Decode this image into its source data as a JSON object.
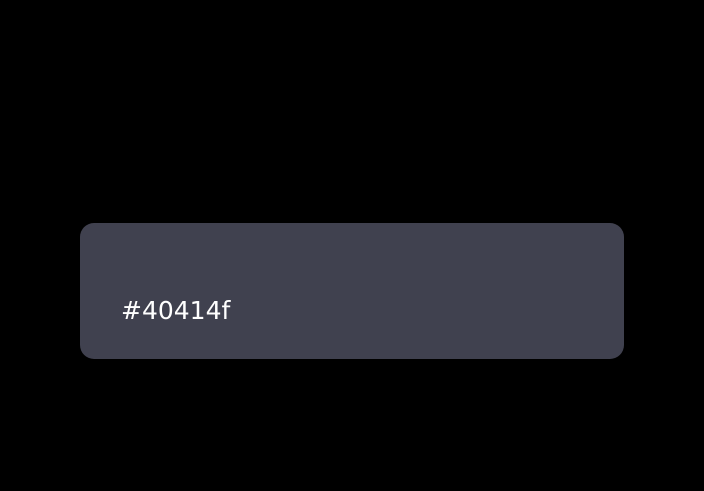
{
  "swatch": {
    "label": "#40414f",
    "color": "#40414f",
    "text_color": "#ffffff"
  },
  "background_color": "#000000"
}
